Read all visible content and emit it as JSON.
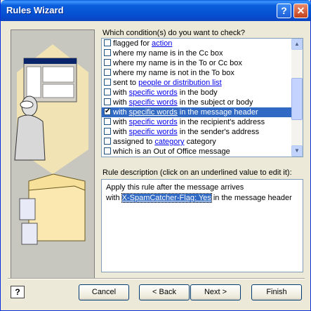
{
  "window": {
    "title": "Rules Wizard",
    "help_glyph": "?",
    "close_glyph": "✕"
  },
  "conditions": {
    "prompt": "Which condition(s) do you want to check?",
    "items": [
      {
        "pre": "flagged for ",
        "link": "action",
        "post": "",
        "checked": false,
        "selected": false
      },
      {
        "pre": "where my name is in the Cc box",
        "link": "",
        "post": "",
        "checked": false,
        "selected": false
      },
      {
        "pre": "where my name is in the To or Cc box",
        "link": "",
        "post": "",
        "checked": false,
        "selected": false
      },
      {
        "pre": "where my name is not in the To box",
        "link": "",
        "post": "",
        "checked": false,
        "selected": false
      },
      {
        "pre": "sent to ",
        "link": "people or distribution list",
        "post": "",
        "checked": false,
        "selected": false
      },
      {
        "pre": "with ",
        "link": "specific words",
        "post": " in the body",
        "checked": false,
        "selected": false
      },
      {
        "pre": "with ",
        "link": "specific words",
        "post": " in the subject or body",
        "checked": false,
        "selected": false
      },
      {
        "pre": "with ",
        "link": "specific words",
        "post": " in the message header",
        "checked": true,
        "selected": true
      },
      {
        "pre": "with ",
        "link": "specific words",
        "post": " in the recipient's address",
        "checked": false,
        "selected": false
      },
      {
        "pre": "with ",
        "link": "specific words",
        "post": " in the sender's address",
        "checked": false,
        "selected": false
      },
      {
        "pre": "assigned to ",
        "link": "category",
        "post": " category",
        "checked": false,
        "selected": false
      },
      {
        "pre": "which is an Out of Office message",
        "link": "",
        "post": "",
        "checked": false,
        "selected": false
      }
    ]
  },
  "description": {
    "label": "Rule description (click on an underlined value to edit it):",
    "line1": "Apply this rule after the message arrives",
    "line2_pre": "with ",
    "line2_link": "X-SpamCatcher-Flag: Yes",
    "line2_post": " in the message header"
  },
  "buttons": {
    "cancel": "Cancel",
    "back": "< Back",
    "next": "Next >",
    "finish": "Finish",
    "help": "?"
  },
  "icons": [
    "help-icon",
    "close-icon",
    "scroll-up-icon",
    "scroll-down-icon",
    "wizard-illustration"
  ]
}
